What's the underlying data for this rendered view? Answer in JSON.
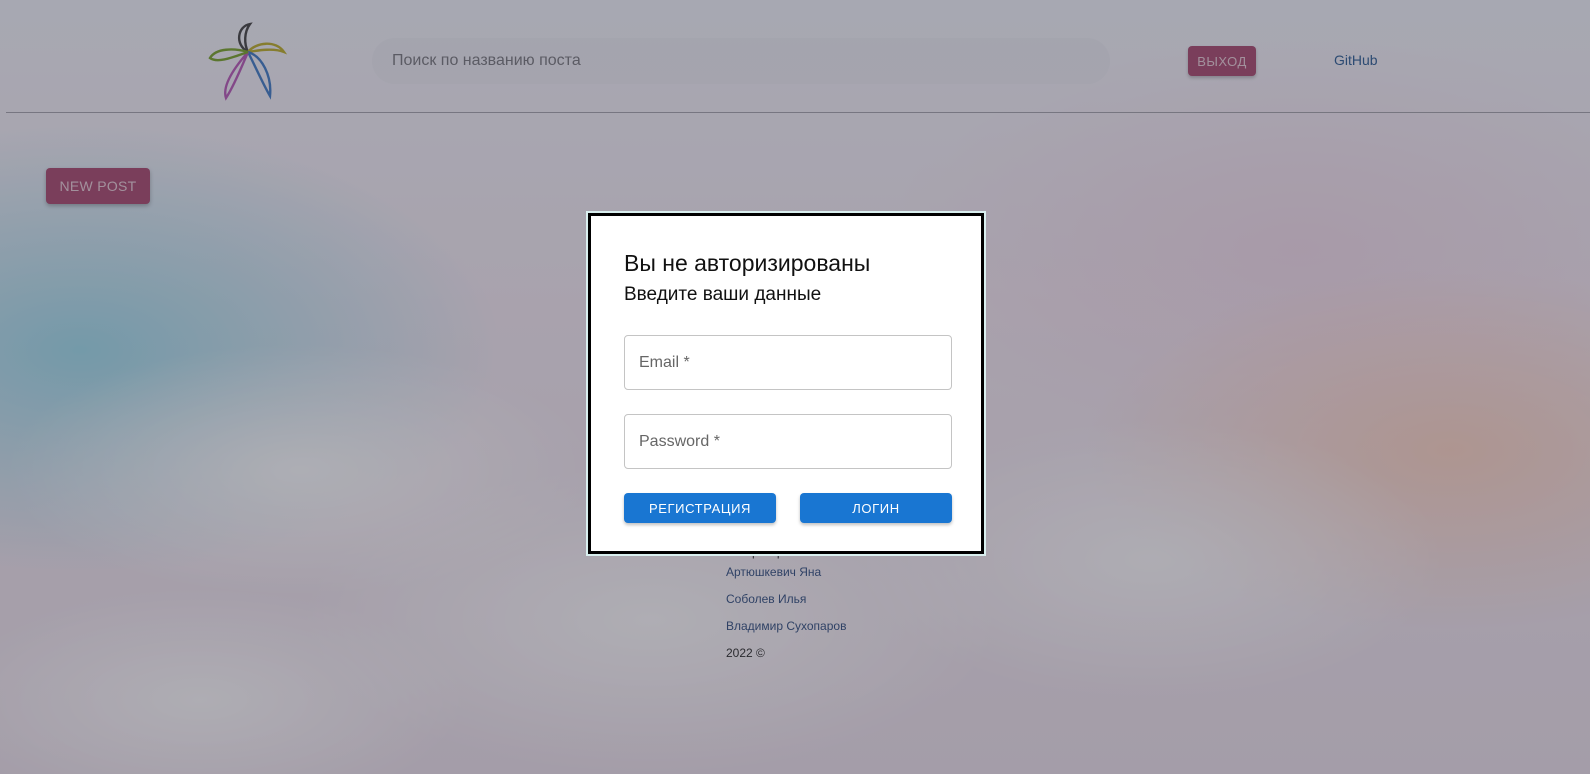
{
  "header": {
    "search_placeholder": "Поиск по названию поста",
    "exit_label": "ВЫХОД",
    "github_label": "GitHub"
  },
  "main": {
    "new_post_label": "NEW POST"
  },
  "footer": {
    "partial_text": "Ратарь Ирина",
    "authors": [
      "Артюшкевич Яна",
      "Соболев Илья",
      "Владимир Сухопаров"
    ],
    "copyright": "2022 ©"
  },
  "modal": {
    "title": "Вы не авторизированы",
    "subtitle": "Введите ваши данные",
    "email_placeholder": "Email *",
    "password_placeholder": "Password *",
    "register_label": "РЕГИСТРАЦИЯ",
    "login_label": "ЛОГИН"
  },
  "colors": {
    "accent_pink": "#a03a62",
    "primary_blue": "#1976d2",
    "link_blue": "#1b4f8a"
  },
  "icons": {
    "logo": "flower-logo-icon"
  }
}
